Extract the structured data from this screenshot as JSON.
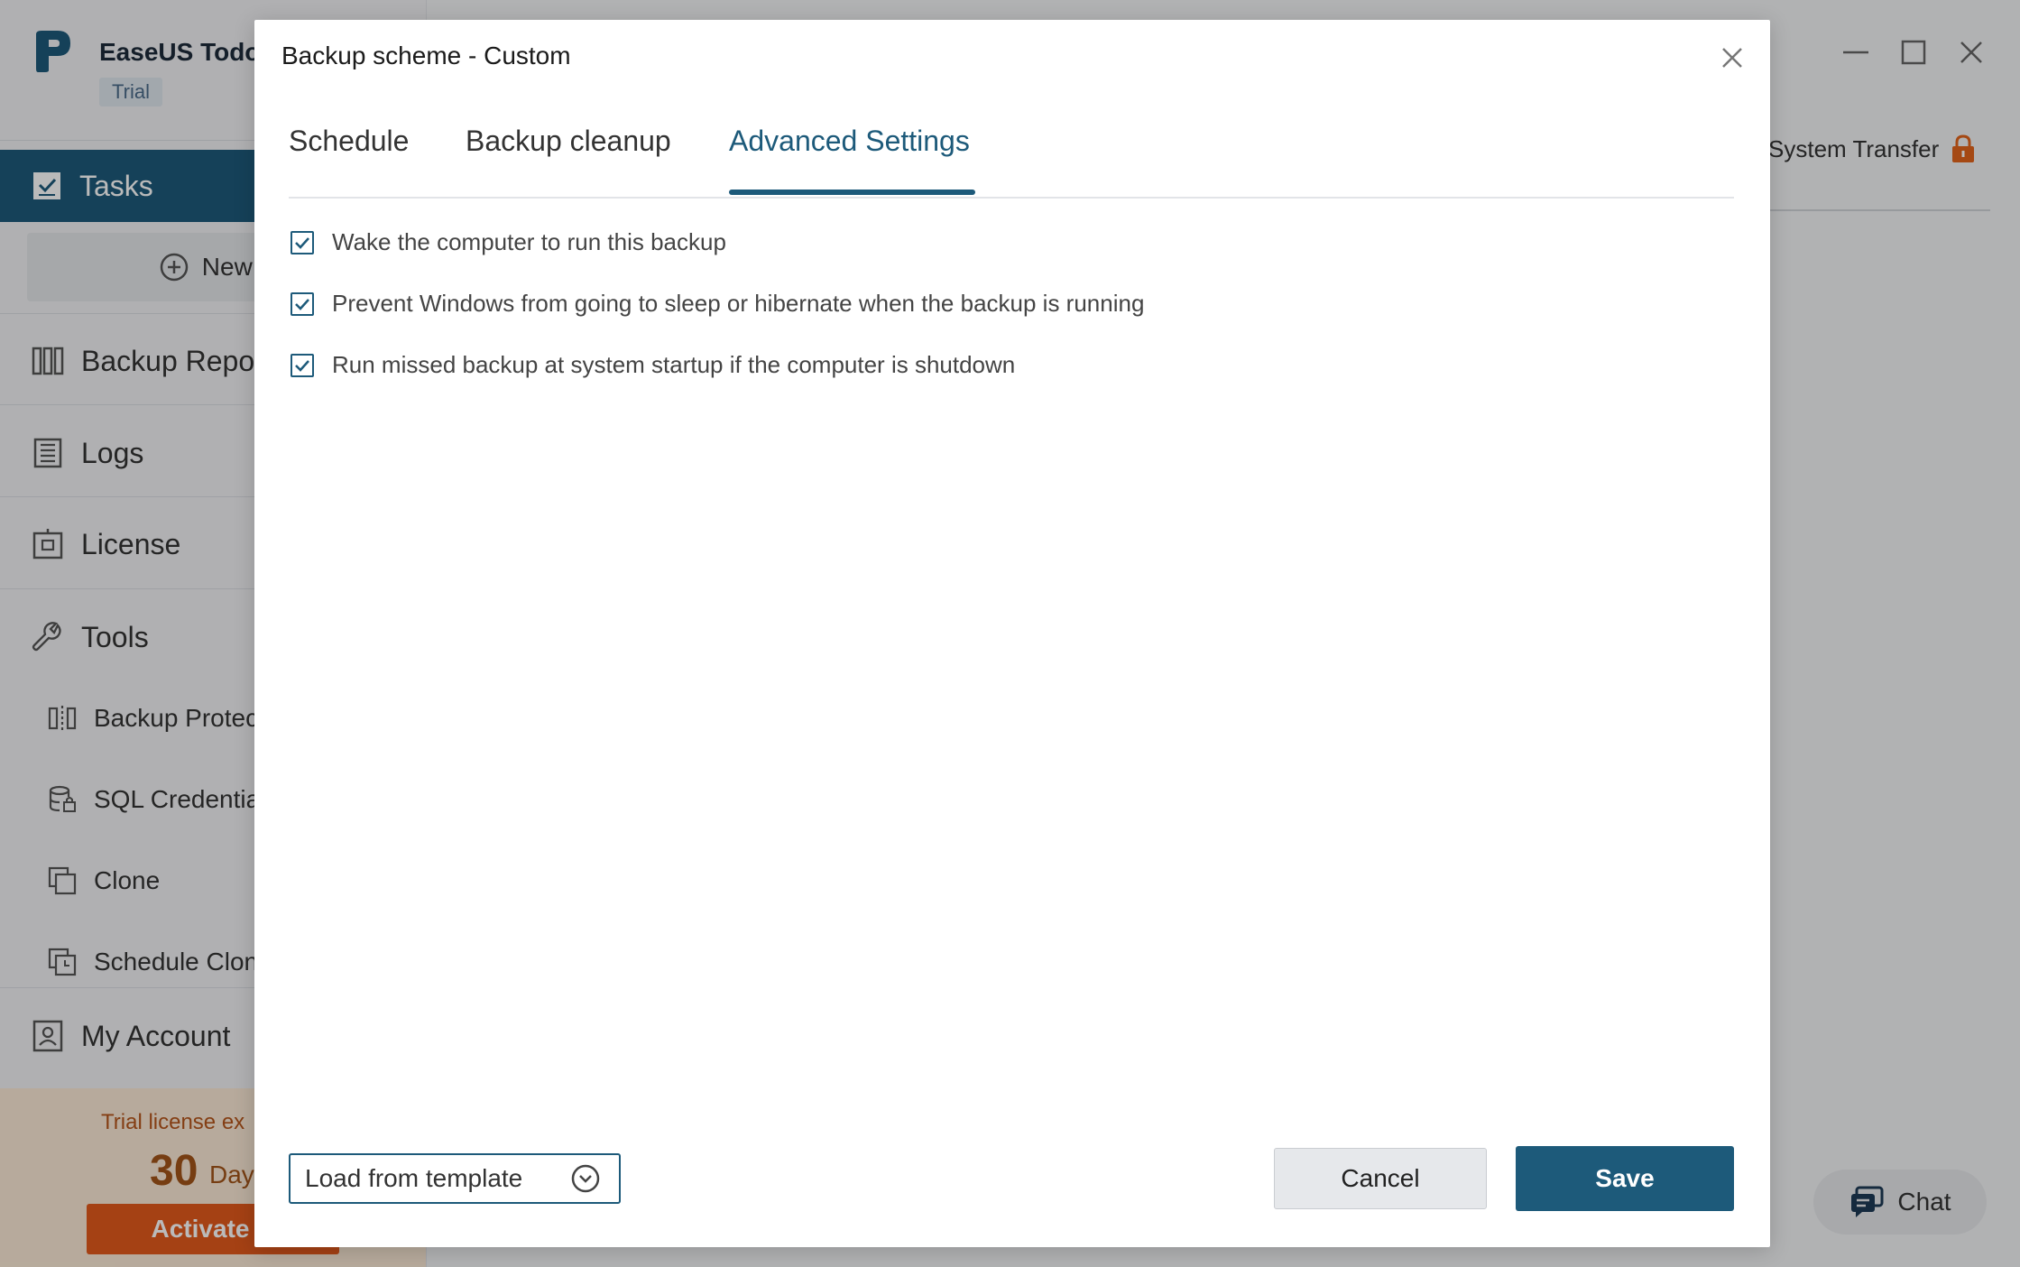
{
  "app": {
    "name": "EaseUS Todo",
    "badge": "Trial"
  },
  "sidebar": {
    "tasks_label": "Tasks",
    "new_task_label": "New T",
    "items": [
      {
        "label": "Backup Repos",
        "icon": "backup-repository-icon"
      },
      {
        "label": "Logs",
        "icon": "logs-icon"
      },
      {
        "label": "License",
        "icon": "license-icon"
      },
      {
        "label": "Tools",
        "icon": "tools-icon"
      }
    ],
    "tools_items": [
      {
        "label": "Backup Protec",
        "icon": "backup-protection-icon"
      },
      {
        "label": "SQL Credentia",
        "icon": "sql-credential-icon"
      },
      {
        "label": "Clone",
        "icon": "clone-icon"
      },
      {
        "label": "Schedule Clon",
        "icon": "schedule-clone-icon"
      }
    ],
    "account_label": "My Account",
    "trial": {
      "text": "Trial license ex",
      "days": "30",
      "days_unit": "Day",
      "activate_label": "Activate N"
    }
  },
  "header": {
    "system_transfer_label": "System Transfer"
  },
  "chat_label": "Chat",
  "dialog": {
    "title": "Backup scheme - Custom",
    "tabs": [
      {
        "label": "Schedule",
        "active": false
      },
      {
        "label": "Backup cleanup",
        "active": false
      },
      {
        "label": "Advanced Settings",
        "active": true
      }
    ],
    "options": [
      {
        "label": "Wake the computer to run this backup",
        "checked": true
      },
      {
        "label": "Prevent Windows from going to sleep or hibernate when the backup is running",
        "checked": true
      },
      {
        "label": "Run missed backup at system startup if the computer is shutdown",
        "checked": true
      }
    ],
    "template_select": {
      "label": "Load from template"
    },
    "cancel_label": "Cancel",
    "save_label": "Save"
  },
  "colors": {
    "accent": "#1d5a7a",
    "trial_bg": "#fbead6",
    "activate": "#e25a1c"
  }
}
